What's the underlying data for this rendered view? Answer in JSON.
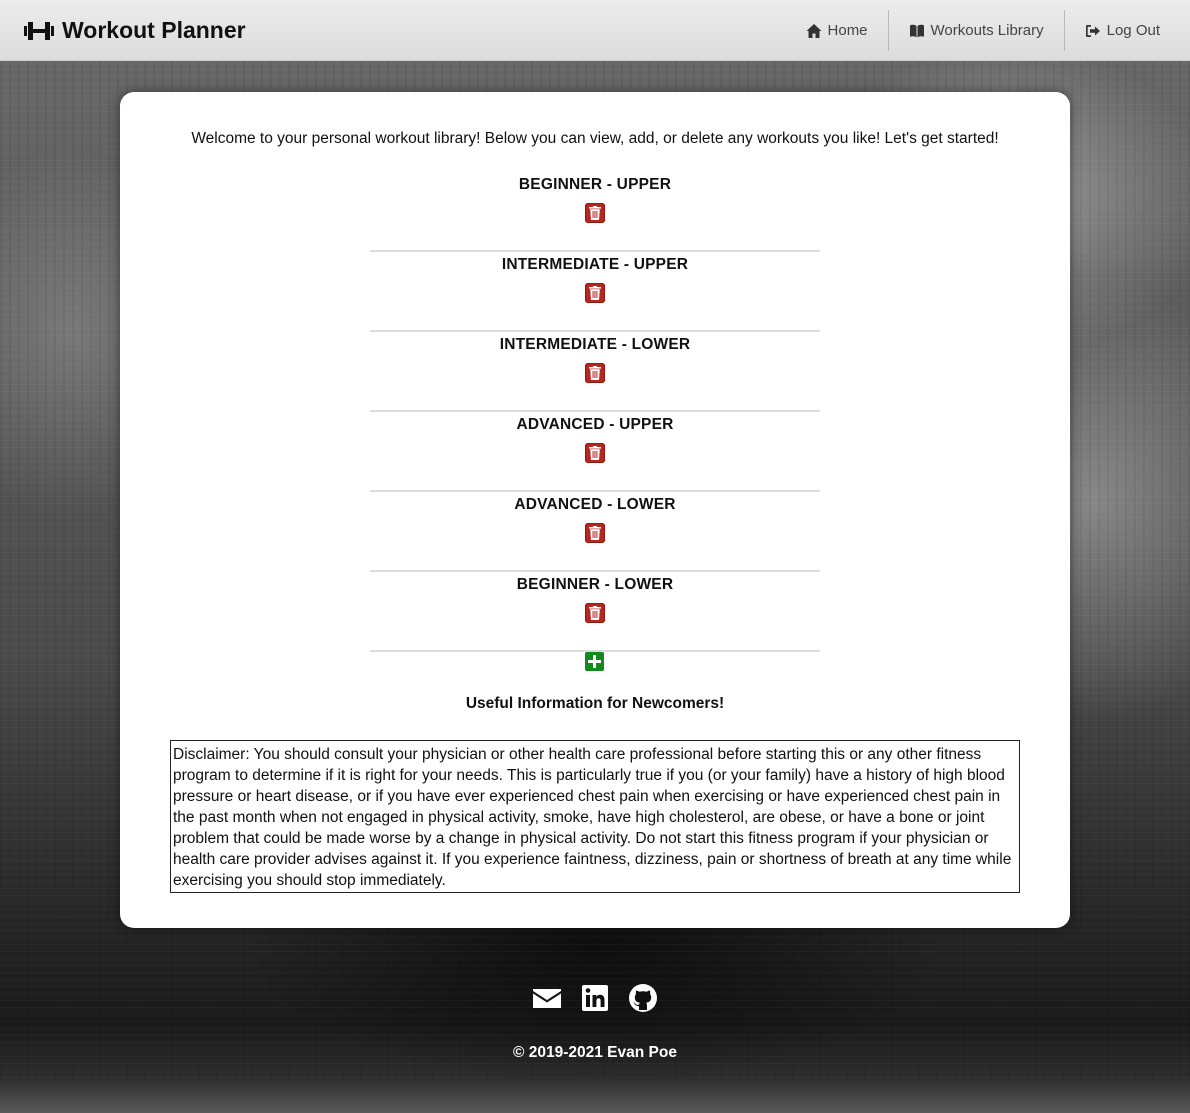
{
  "nav": {
    "brand": "Workout Planner",
    "links": [
      {
        "label": "Home",
        "icon": "home-icon"
      },
      {
        "label": "Workouts Library",
        "icon": "book-icon"
      },
      {
        "label": "Log Out",
        "icon": "sign-out-icon"
      }
    ]
  },
  "main": {
    "welcome": "Welcome to your personal workout library! Below you can view, add, or delete any workouts you like! Let's get started!",
    "workouts": [
      {
        "name": "BEGINNER - UPPER"
      },
      {
        "name": "INTERMEDIATE - UPPER"
      },
      {
        "name": "INTERMEDIATE - LOWER"
      },
      {
        "name": "ADVANCED - UPPER"
      },
      {
        "name": "ADVANCED - LOWER"
      },
      {
        "name": "BEGINNER - LOWER"
      }
    ],
    "useful_heading": "Useful Information for Newcomers!",
    "disclaimer": "Disclaimer: You should consult your physician or other health care professional before starting this or any other fitness program to determine if it is right for your needs. This is particularly true if you (or your family) have a history of high blood pressure or heart disease, or if you have ever experienced chest pain when exercising or have experienced chest pain in the past month when not engaged in physical activity, smoke, have high cholesterol, are obese, or have a bone or joint problem that could be made worse by a change in physical activity. Do not start this fitness program if your physician or health care provider advises against it. If you experience faintness, dizziness, pain or shortness of breath at any time while exercising you should stop immediately."
  },
  "footer": {
    "social_icons": [
      "envelope-icon",
      "linkedin-icon",
      "github-icon"
    ],
    "copyright": "© 2019-2021 Evan Poe"
  },
  "colors": {
    "delete": "#b8271f",
    "add": "#128a1e",
    "navbar": "#e4e4e4"
  }
}
